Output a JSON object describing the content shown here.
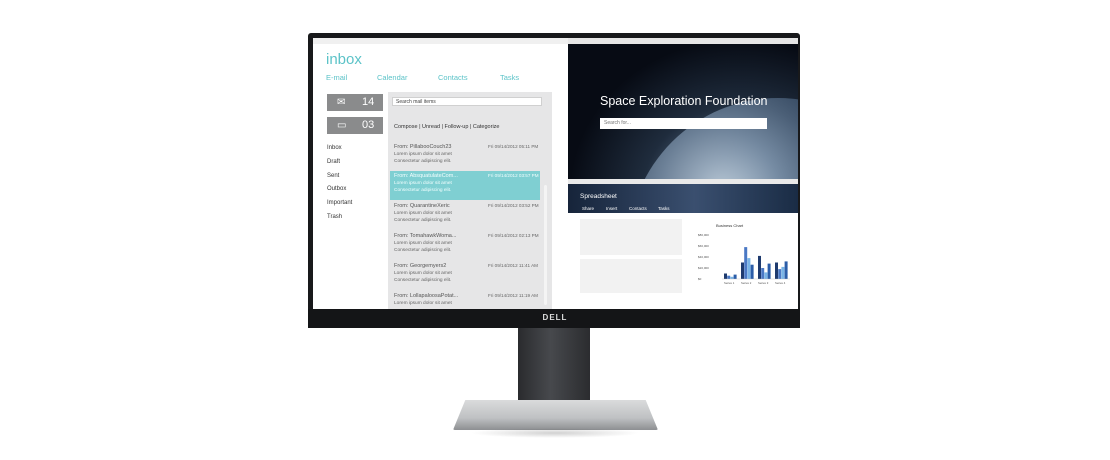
{
  "brand": {
    "logo": "DELL"
  },
  "mail": {
    "title": "inbox",
    "tabs": [
      "E-mail",
      "Calendar",
      "Contacts",
      "Tasks"
    ],
    "counters": [
      {
        "icon": "envelope-icon",
        "glyph": "✉",
        "value": "14"
      },
      {
        "icon": "chat-icon",
        "glyph": "▭",
        "value": "03"
      }
    ],
    "folders": [
      "Inbox",
      "Draft",
      "Sent",
      "Outbox",
      "Important",
      "Trash"
    ],
    "search_placeholder": "Search mail items",
    "toolbar": "Compose   |   Unread   |   Follow-up   |   Categorize",
    "messages": [
      {
        "from": "From: PillabooCouch23",
        "date": "Fri 09/14/2012 05:11 PM",
        "line1": "Lorem ipsum dolor sit amet",
        "line2": "Consectetur adipiscing elit.",
        "selected": false
      },
      {
        "from": "From: AbsquatulateCom...",
        "date": "Fri 09/14/2012 03:57 PM",
        "line1": "Lorem ipsum dolor sit amet",
        "line2": "Consectetur adipiscing elit.",
        "selected": true
      },
      {
        "from": "From: QuarantineXeric",
        "date": "Fri 09/14/2012 03:52 PM",
        "line1": "Lorem ipsum dolor sit amet",
        "line2": "Consectetur adipiscing elit.",
        "selected": false
      },
      {
        "from": "From: TomahawkWoma...",
        "date": "Fri 09/14/2012 02:13 PM",
        "line1": "Lorem ipsum dolor sit amet",
        "line2": "Consectetur adipiscing elit.",
        "selected": false
      },
      {
        "from": "From: Georgemyers2",
        "date": "Fri 09/14/2012 11:41 AM",
        "line1": "Lorem ipsum dolor sit amet",
        "line2": "Consectetur adipiscing elit.",
        "selected": false
      },
      {
        "from": "From: LollapaloosaPotat...",
        "date": "Fri 09/14/2012 11:19 AM",
        "line1": "Lorem ipsum dolor sit amet",
        "line2": "",
        "selected": false
      }
    ]
  },
  "space": {
    "title": "Space Exploration Foundation",
    "search_placeholder": "Search for..."
  },
  "sheet": {
    "title": "Spreadsheet",
    "tabs": [
      "Share",
      "Insert",
      "Contacts",
      "Tasks"
    ],
    "chart_title": "Business Chart",
    "y_labels": [
      "$80,000",
      "$60,000",
      "$40,000",
      "$20,000",
      "$0"
    ],
    "x_labels": [
      "Series 1",
      "Series 2",
      "Series 3",
      "Series 4"
    ],
    "colors": [
      "#1e3a6e",
      "#4a78c4",
      "#79b4e6",
      "#2b5da8"
    ]
  },
  "chart_data": {
    "type": "bar",
    "title": "Business Chart",
    "categories": [
      "Series 1",
      "Series 2",
      "Series 3",
      "Series 4"
    ],
    "series": [
      {
        "values": [
          10000,
          30000,
          42000,
          30000
        ]
      },
      {
        "values": [
          6000,
          58000,
          20000,
          18000
        ]
      },
      {
        "values": [
          4000,
          38000,
          12000,
          22000
        ]
      },
      {
        "values": [
          8000,
          26000,
          28000,
          32000
        ]
      }
    ],
    "ylim": [
      0,
      80000
    ]
  }
}
